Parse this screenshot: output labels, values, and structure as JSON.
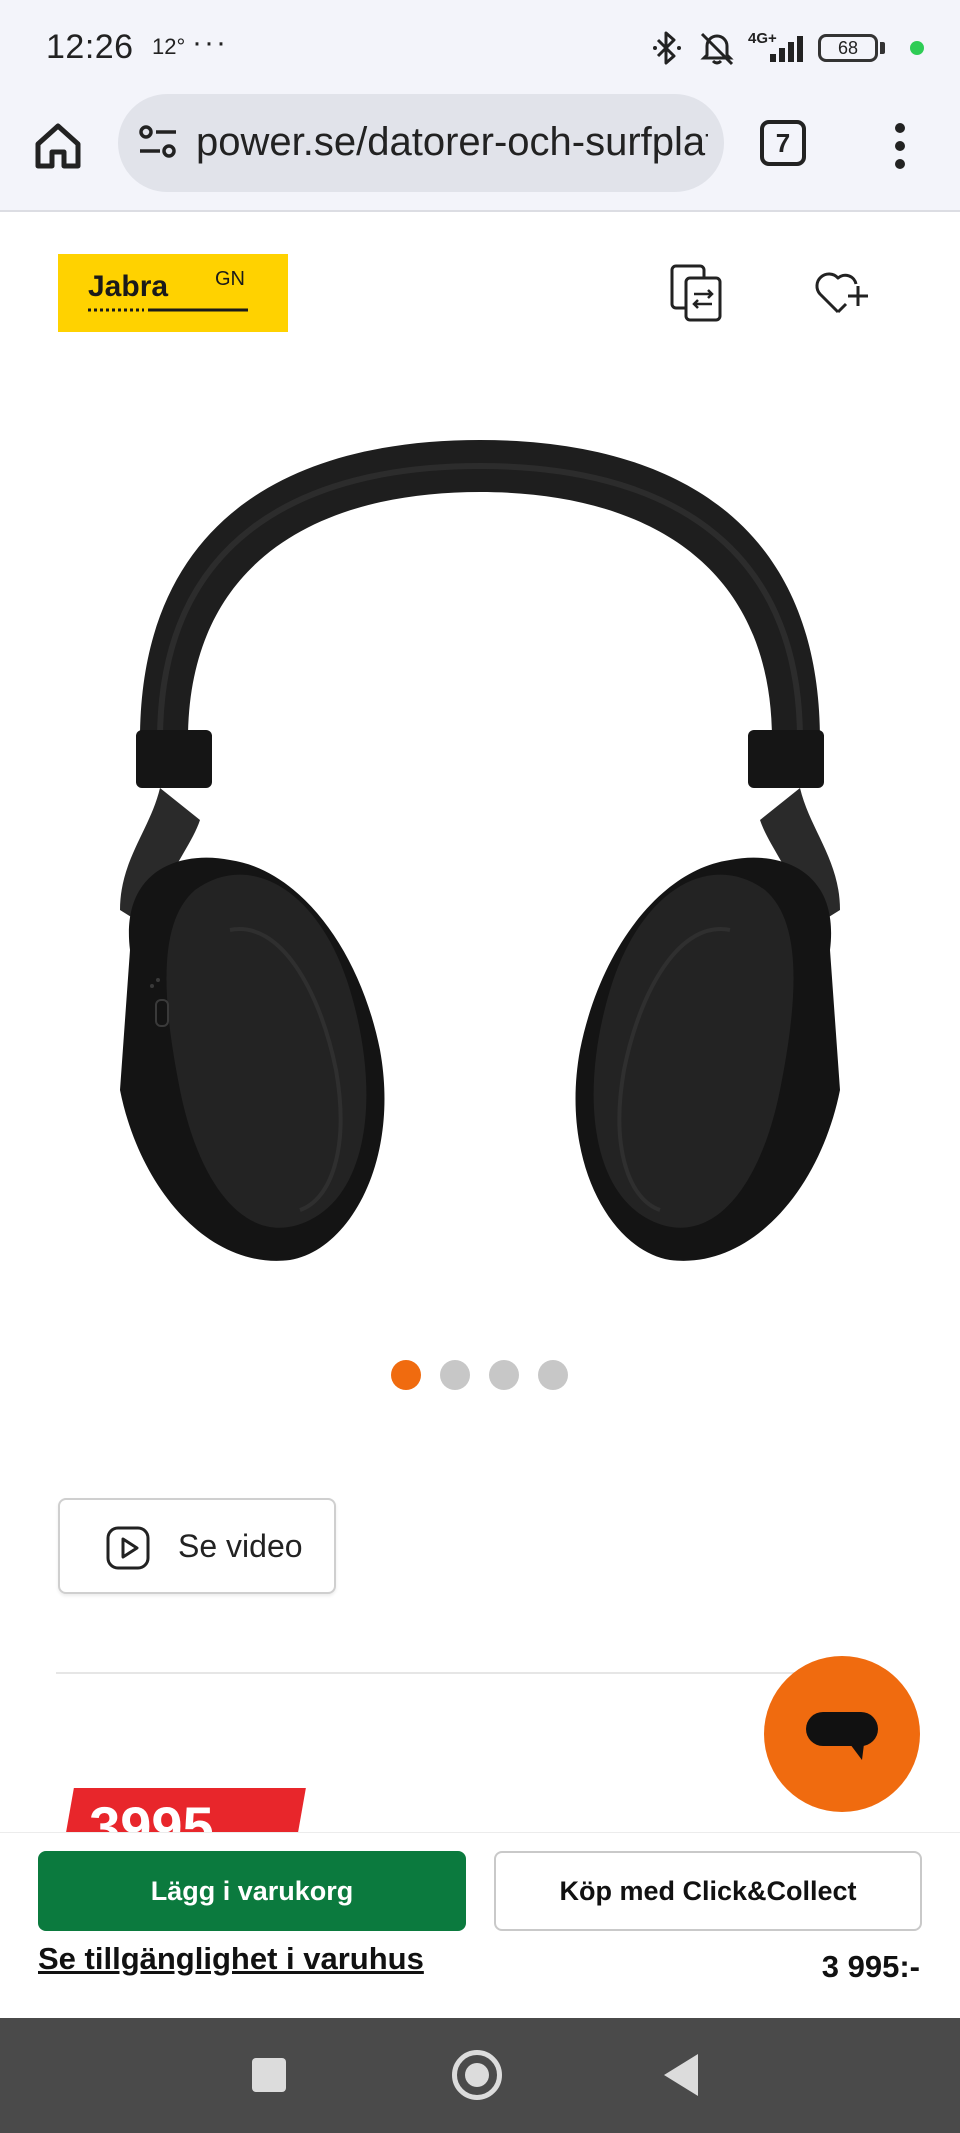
{
  "status_bar": {
    "time": "12:26",
    "temperature": "12°",
    "more": "···",
    "network": "4G+",
    "battery": "68"
  },
  "browser": {
    "url": "power.se/datorer-och-surfplattor",
    "tab_count": "7"
  },
  "brand": {
    "logo_text": "Jabra",
    "logo_suffix": "GN",
    "logo_color": "#ffd200"
  },
  "gallery": {
    "image_count": 4,
    "active_index": 0,
    "active_color": "#f06b0f"
  },
  "video_button": {
    "label": "Se video"
  },
  "price_tag": {
    "value": "3995"
  },
  "buy_bar": {
    "cart_label": "Lägg i varukorg",
    "click_collect_label": "Köp med Click&Collect",
    "store_availability_label": "Se tillgänglighet i varuhus",
    "price": "3 995:-",
    "cart_color": "#0b7a3e"
  },
  "icons": {
    "home": "home-icon",
    "site_settings": "tune-icon",
    "menu": "more-vert-icon",
    "compare": "compare-icon",
    "wishlist": "heart-plus-icon",
    "video": "play-icon",
    "chat": "chat-icon"
  }
}
